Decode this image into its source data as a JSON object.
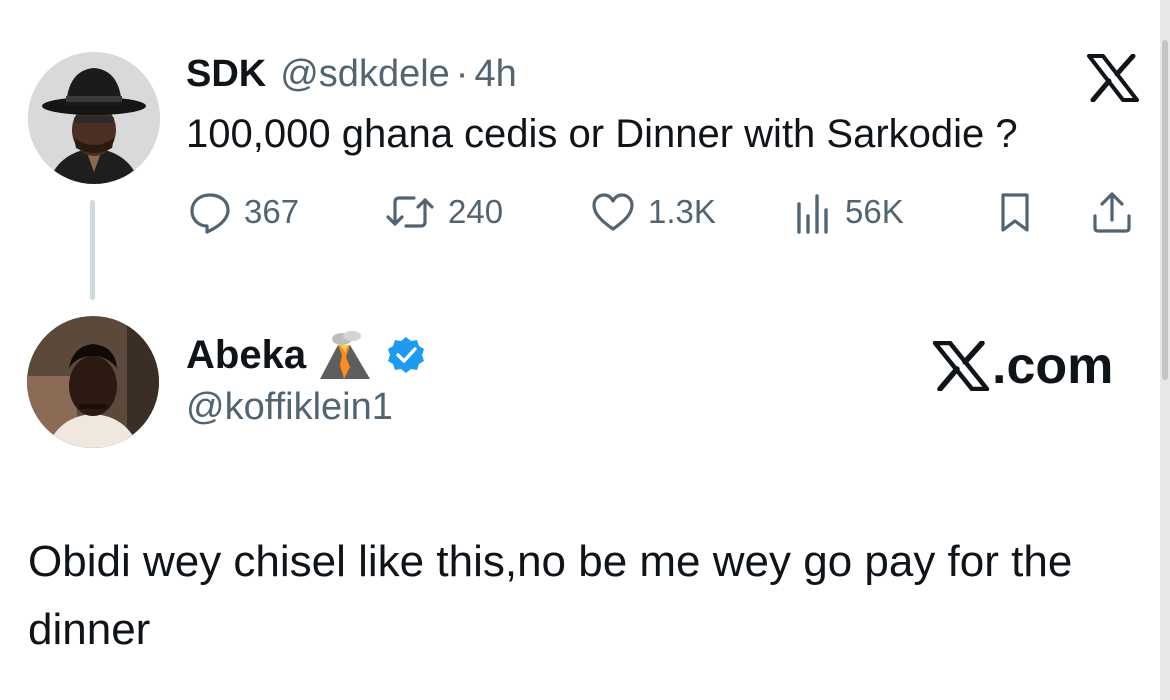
{
  "tweet1": {
    "name": "SDK",
    "handle": "@sdkdele",
    "separator": "·",
    "time": "4h",
    "text": "100,000 ghana cedis or Dinner with Sarkodie ?",
    "stats": {
      "replies": "367",
      "retweets": "240",
      "likes": "1.3K",
      "views": "56K"
    },
    "icons": [
      "reply-icon",
      "retweet-icon",
      "like-icon",
      "views-icon",
      "bookmark-icon",
      "share-icon",
      "x-logo-icon"
    ]
  },
  "tweet2": {
    "name": "Abeka",
    "handle": "@koffiklein1",
    "badge_icons": [
      "volcano-emoji-icon",
      "verified-badge-icon"
    ],
    "source_label": ".com",
    "text": "Obidi wey chisel like this,no be me wey go pay for the dinner"
  },
  "colors": {
    "text": "#0f1419",
    "secondary": "#536471",
    "verified": "#1d9bf0",
    "thread_line": "#cfd9de"
  }
}
